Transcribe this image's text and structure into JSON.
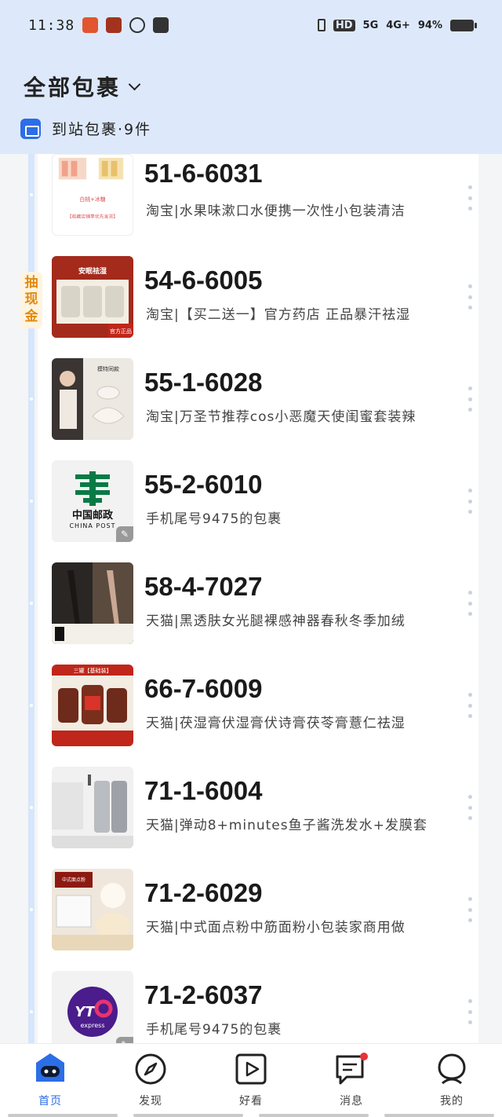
{
  "status_bar": {
    "time": "11:38",
    "network_1": "HD",
    "network_2": "5G",
    "network_3": "4G+",
    "battery": "94%"
  },
  "header": {
    "title": "全部包裹",
    "subtitle": "到站包裹·9件"
  },
  "promo": {
    "label": "抽现金"
  },
  "packages": [
    {
      "code": "51-6-6031",
      "desc": "淘宝|水果味漱口水便携一次性小包装清洁",
      "thumb": "mouthwash-product"
    },
    {
      "code": "54-6-6005",
      "desc": "淘宝|【买二送一】官方药店 正品暴汗祛湿",
      "thumb": "herbal-jar-product"
    },
    {
      "code": "55-1-6028",
      "desc": "淘宝|万圣节推荐cos小恶魔天使闺蜜套装辣",
      "thumb": "costume-product"
    },
    {
      "code": "55-2-6010",
      "desc": "手机尾号9475的包裹",
      "thumb": "china-post-logo"
    },
    {
      "code": "58-4-7027",
      "desc": "天猫|黑透肤女光腿裸感神器春秋冬季加绒",
      "thumb": "stockings-product"
    },
    {
      "code": "66-7-6009",
      "desc": "天猫|茯湿膏伏湿膏伏诗膏茯苓膏薏仁祛湿",
      "thumb": "paste-jar-product"
    },
    {
      "code": "71-1-6004",
      "desc": "天猫|弹动8+minutes鱼子酱洗发水+发膜套",
      "thumb": "shampoo-product"
    },
    {
      "code": "71-2-6029",
      "desc": "天猫|中式面点粉中筋面粉小包装家商用做",
      "thumb": "flour-product"
    },
    {
      "code": "71-2-6037",
      "desc": "手机尾号9475的包裹",
      "thumb": "yto-express-logo"
    }
  ],
  "thumb_texts": {
    "p1_top": "白桃+冰糖",
    "p1_bottom": "【收藏店铺享优先发货】",
    "p2_top": "安眠祛湿",
    "p2_tag": "官方正品",
    "p3_top": "模特同款",
    "post_cn": "中国邮政",
    "post_en": "CHINA POST",
    "p6_top": "三罐【基础装】",
    "p8_top": "中式面点粉",
    "yto": "express"
  },
  "bottom_nav": [
    {
      "label": "首页",
      "icon": "home-robot-icon",
      "active": true
    },
    {
      "label": "发现",
      "icon": "compass-icon",
      "active": false
    },
    {
      "label": "好看",
      "icon": "play-icon",
      "active": false
    },
    {
      "label": "消息",
      "icon": "message-icon",
      "active": false
    },
    {
      "label": "我的",
      "icon": "profile-icon",
      "active": false
    }
  ],
  "colors": {
    "header_bg": "#dde9fb",
    "accent": "#2b6ee6",
    "promo": "#e08a0e",
    "notification_dot": "#e8333a"
  }
}
